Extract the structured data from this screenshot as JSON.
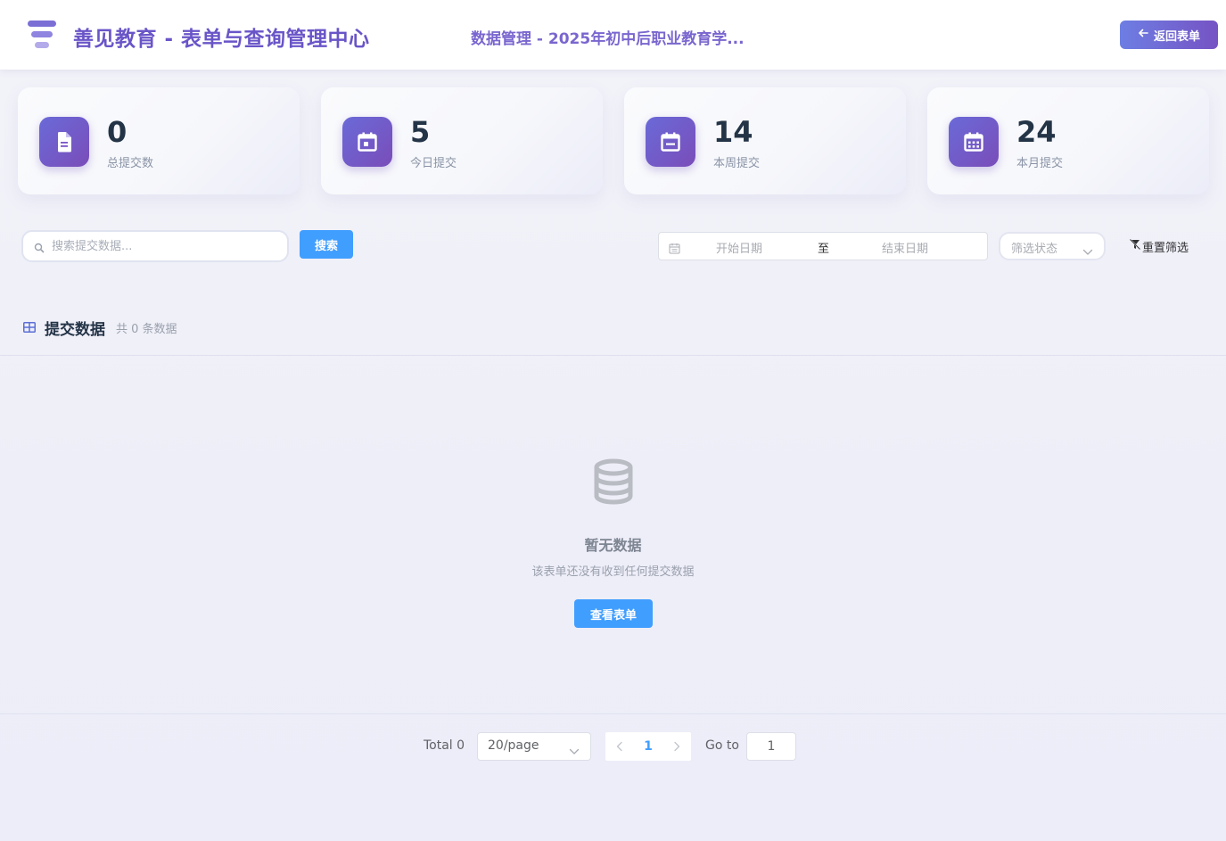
{
  "header": {
    "brand_title": "善见教育 - 表单与查询管理中心",
    "subtitle": "数据管理 - 2025年初中后职业教育学...",
    "back_button_label": "返回表单"
  },
  "stats": [
    {
      "value": "0",
      "label": "总提交数",
      "icon": "document-icon"
    },
    {
      "value": "5",
      "label": "今日提交",
      "icon": "calendar-day-icon"
    },
    {
      "value": "14",
      "label": "本周提交",
      "icon": "calendar-week-icon"
    },
    {
      "value": "24",
      "label": "本月提交",
      "icon": "calendar-month-icon"
    }
  ],
  "filters": {
    "search_placeholder": "搜索提交数据...",
    "search_button_label": "搜索",
    "date_start_placeholder": "开始日期",
    "date_separator": "至",
    "date_end_placeholder": "结束日期",
    "status_placeholder": "筛选状态",
    "reset_label": "重置筛选"
  },
  "table": {
    "title": "提交数据",
    "count_text": "共 0 条数据",
    "empty_title": "暂无数据",
    "empty_desc": "该表单还没有收到任何提交数据",
    "view_form_label": "查看表单"
  },
  "pagination": {
    "total_text": "Total 0",
    "page_size": "20/page",
    "current_page": "1",
    "goto_label": "Go to",
    "goto_value": "1"
  },
  "colors": {
    "brand": "#6a55c8",
    "accent_blue": "#409eff",
    "icon_gradient_start": "#6a6ad8",
    "icon_gradient_end": "#7a4db9"
  }
}
